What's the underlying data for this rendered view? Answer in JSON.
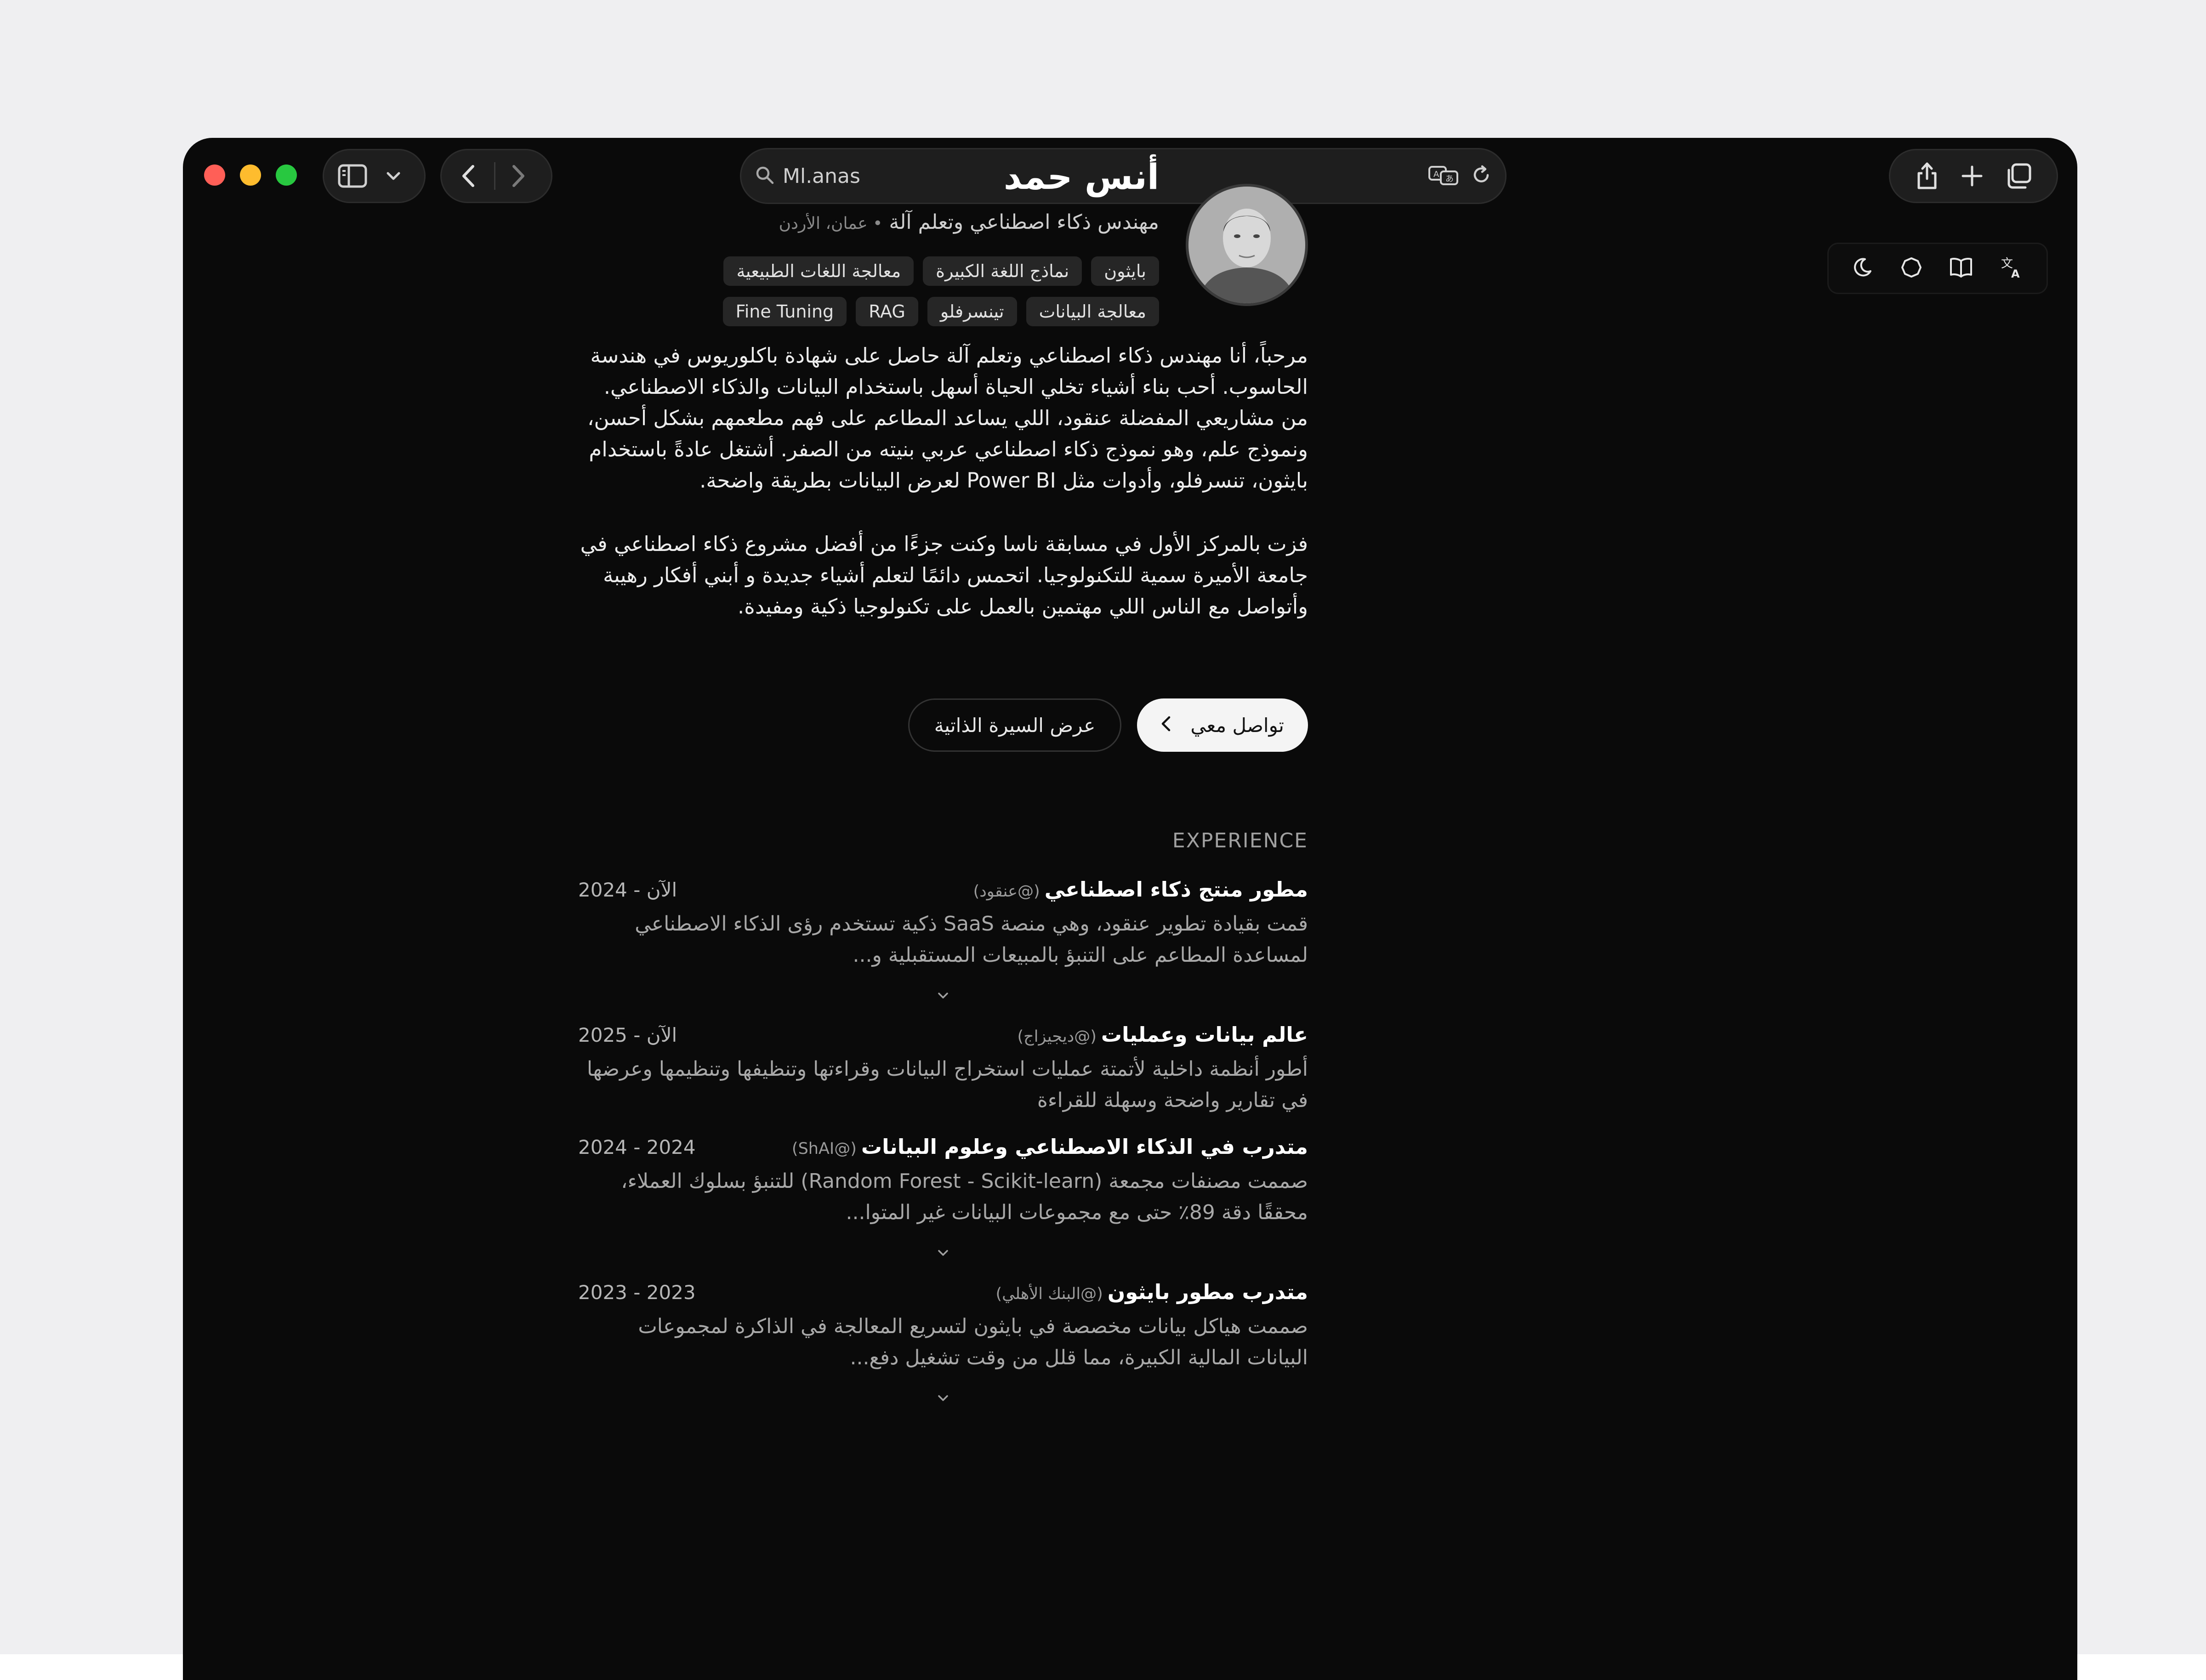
{
  "browser": {
    "address": "Ml.anas"
  },
  "profile": {
    "name": "أنس حمد",
    "role": "مهندس ذكاء اصطناعي وتعلم آلة",
    "location": "• عمان، الأردن",
    "tags": [
      "بايثون",
      "نماذج اللغة الكبيرة",
      "معالجة اللغات الطبيعية",
      "معالجة البيانات",
      "تينسرفلو",
      "RAG",
      "Fine Tuning"
    ]
  },
  "bio": {
    "p1": "مرحباً، أنا مهندس ذكاء اصطناعي وتعلم آلة حاصل على شهادة باكلوريوس في هندسة الحاسوب. أحب بناء أشياء تخلي الحياة أسهل باستخدام البيانات والذكاء الاصطناعي. من مشاريعي المفضلة عنقود، اللي يساعد المطاعم على فهم مطعمهم بشكل أحسن، ونموذج علم، وهو نموذج ذكاء اصطناعي عربي بنيته من الصفر. أشتغل عادةً باستخدام بايثون، تنسرفلو، وأدوات مثل Power BI لعرض البيانات بطريقة واضحة.",
    "p2": "فزت بالمركز الأول في مسابقة ناسا وكنت جزءًا من أفضل مشروع ذكاء اصطناعي في جامعة الأميرة سمية للتكنولوجيا. اتحمس دائمًا لتعلم أشياء جديدة و أبني أفكار رهيبة وأتواصل مع الناس اللي مهتمين بالعمل على تكنولوجيا ذكية ومفيدة."
  },
  "cta": {
    "contact_label": "تواصل معي",
    "resume_label": "عرض السيرة الذاتية"
  },
  "experience": {
    "title": "EXPERIENCE",
    "jobs": [
      {
        "title": "مطور منتج ذكاء اصطناعي",
        "company": "(@عنقود)",
        "date": "2024 - الآن",
        "desc": "قمت بقيادة تطوير عنقود، وهي منصة SaaS ذكية تستخدم رؤى الذكاء الاصطناعي لمساعدة المطاعم على التنبؤ بالمبيعات المستقبلية و..."
      },
      {
        "title": "عالم بيانات وعمليات",
        "company": "(@ديجيزاج)",
        "date": "2025 - الآن",
        "desc": "أطور أنظمة داخلية لأتمتة عمليات استخراج البيانات وقراءتها وتنظيفها وتنظيمها وعرضها في تقارير واضحة وسهلة للقراءة"
      },
      {
        "title": "متدرب في الذكاء الاصطناعي وعلوم البيانات",
        "company": "(@ShAI)",
        "date": "2024 - 2024",
        "desc": "صممت مصنفات مجمعة (Random Forest - Scikit-learn) للتنبؤ بسلوك العملاء، محققًا دقة 89٪ حتى مع مجموعات البيانات غير المتوا..."
      },
      {
        "title": "متدرب مطور بايثون",
        "company": "(@البنك الأهلي)",
        "date": "2023 - 2023",
        "desc": "صممت هياكل بيانات مخصصة في بايثون لتسريع المعالجة في الذاكرة لمجموعات البيانات المالية الكبيرة، مما قلل من وقت تشغيل دفع..."
      }
    ]
  }
}
